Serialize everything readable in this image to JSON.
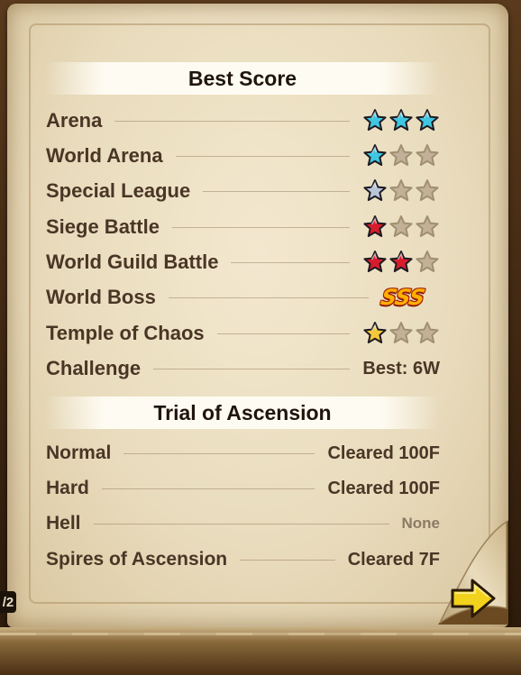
{
  "best_score": {
    "title": "Best Score",
    "rows": [
      {
        "label": "Arena",
        "stars": {
          "filled": 3,
          "total": 3,
          "color": "#3fc6e0"
        }
      },
      {
        "label": "World Arena",
        "stars": {
          "filled": 1,
          "total": 3,
          "color": "#3fc6e0"
        }
      },
      {
        "label": "Special League",
        "stars": {
          "filled": 1,
          "total": 3,
          "color": "#b9c6da"
        }
      },
      {
        "label": "Siege Battle",
        "stars": {
          "filled": 1,
          "total": 3,
          "color": "#d81c2c"
        }
      },
      {
        "label": "World Guild Battle",
        "stars": {
          "filled": 2,
          "total": 3,
          "color": "#d81c2c"
        }
      },
      {
        "label": "World Boss",
        "grade": "SSS"
      },
      {
        "label": "Temple of Chaos",
        "stars": {
          "filled": 1,
          "total": 3,
          "color": "#f5c83a"
        }
      },
      {
        "label": "Challenge",
        "value": "Best: 6W"
      }
    ]
  },
  "trial": {
    "title": "Trial of Ascension",
    "rows": [
      {
        "label": "Normal",
        "value": "Cleared 100F"
      },
      {
        "label": "Hard",
        "value": "Cleared 100F"
      },
      {
        "label": "Hell",
        "value": "None"
      },
      {
        "label": "Spires of Ascension",
        "value": "Cleared 7F"
      }
    ]
  },
  "pagination": {
    "page_label": "/2"
  },
  "colors": {
    "empty_star": "#c2b196",
    "arrow": "#f2d21c"
  }
}
